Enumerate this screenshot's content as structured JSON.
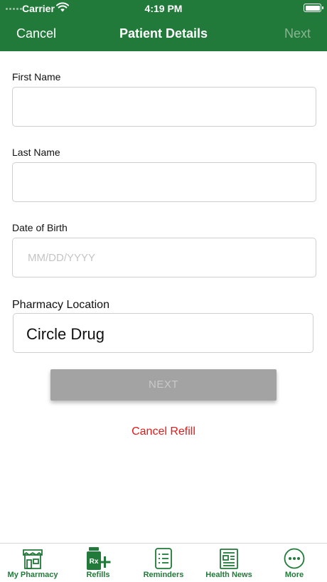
{
  "status_bar": {
    "carrier": "Carrier",
    "time": "4:19 PM",
    "battery_level": 1.0
  },
  "nav": {
    "left": "Cancel",
    "title": "Patient Details",
    "right": "Next"
  },
  "form": {
    "first_name": {
      "label": "First Name",
      "value": "",
      "placeholder": ""
    },
    "last_name": {
      "label": "Last Name",
      "value": "",
      "placeholder": ""
    },
    "dob": {
      "label": "Date of Birth",
      "value": "",
      "placeholder": "MM/DD/YYYY"
    },
    "pharmacy": {
      "label": "Pharmacy Location",
      "value": "Circle Drug"
    }
  },
  "next_button": "NEXT",
  "cancel_refill": "Cancel Refill",
  "tabs": [
    {
      "label": "My Pharmacy",
      "icon": "store-icon"
    },
    {
      "label": "Refills",
      "icon": "rx-plus-icon",
      "badge": "Rx"
    },
    {
      "label": "Reminders",
      "icon": "checklist-icon"
    },
    {
      "label": "Health News",
      "icon": "newspaper-icon"
    },
    {
      "label": "More",
      "icon": "more-icon"
    }
  ],
  "colors": {
    "brand_green": "#217a39",
    "cancel_red": "#e21a1a",
    "disabled_gray": "#a3a3a3"
  }
}
